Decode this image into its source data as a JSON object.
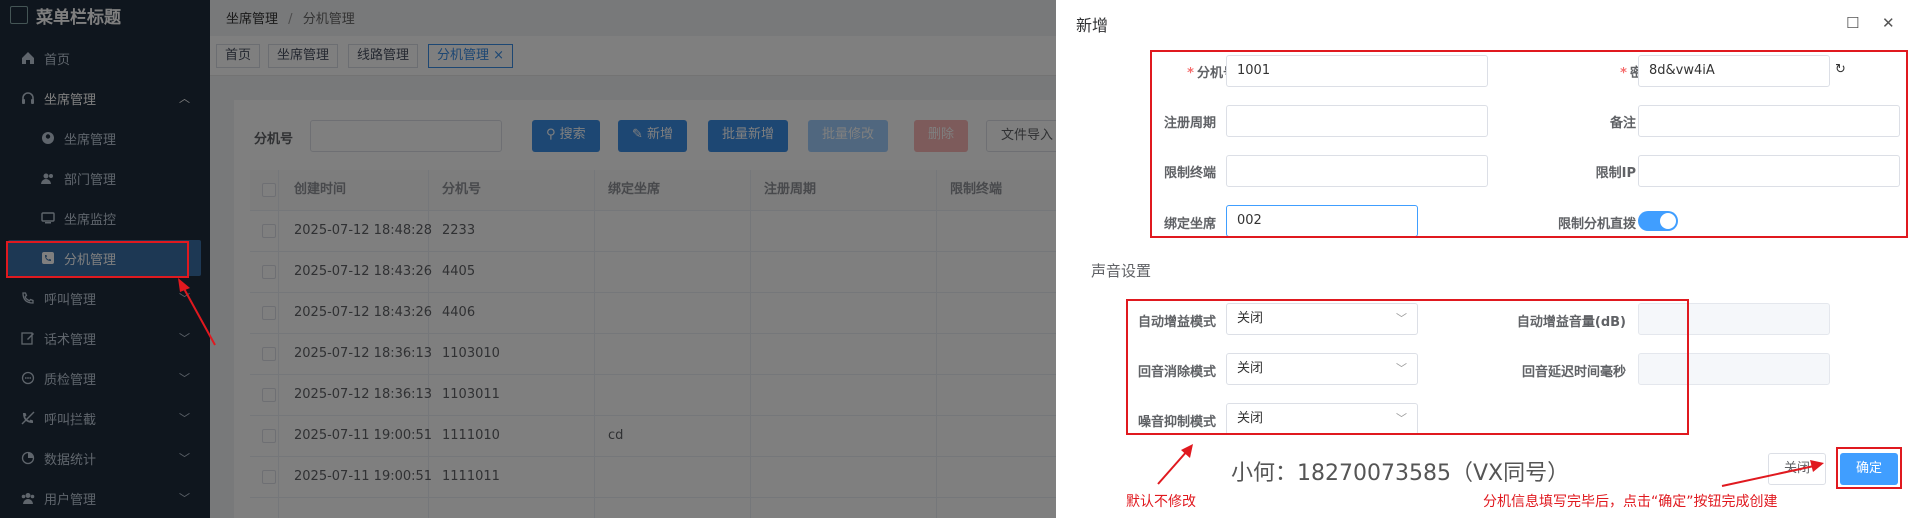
{
  "sidebar": {
    "title": "菜单栏标题",
    "items": [
      {
        "label": "首页",
        "icon": "home-icon"
      },
      {
        "label": "坐席管理",
        "icon": "headset-icon",
        "expanded": true
      },
      {
        "label": "坐席管理",
        "icon": "user-circle-icon",
        "sub": true
      },
      {
        "label": "部门管理",
        "icon": "users-icon",
        "sub": true
      },
      {
        "label": "坐席监控",
        "icon": "monitor-icon",
        "sub": true
      },
      {
        "label": "分机管理",
        "icon": "phone-icon",
        "sub": true,
        "active": true
      },
      {
        "label": "呼叫管理",
        "icon": "phone-call-icon"
      },
      {
        "label": "话术管理",
        "icon": "edit-icon"
      },
      {
        "label": "质检管理",
        "icon": "chat-icon"
      },
      {
        "label": "呼叫拦截",
        "icon": "block-icon"
      },
      {
        "label": "数据统计",
        "icon": "chart-icon"
      },
      {
        "label": "用户管理",
        "icon": "user-group-icon"
      }
    ]
  },
  "breadcrumb": {
    "first": "坐席管理",
    "sep": "/",
    "current": "分机管理"
  },
  "tabs": [
    "首页",
    "坐席管理",
    "线路管理",
    "分机管理 ×"
  ],
  "search": {
    "label": "分机号",
    "buttons": [
      "搜索",
      "新增",
      "批量新增",
      "批量修改",
      "删除",
      "文件导入"
    ]
  },
  "table": {
    "headers": [
      "创建时间",
      "分机号",
      "绑定坐席",
      "注册周期",
      "限制终端"
    ],
    "rows": [
      [
        "2025-07-12 18:48:28",
        "2233",
        ""
      ],
      [
        "2025-07-12 18:43:26",
        "4405",
        ""
      ],
      [
        "2025-07-12 18:43:26",
        "4406",
        ""
      ],
      [
        "2025-07-12 18:36:13",
        "1103010",
        ""
      ],
      [
        "2025-07-12 18:36:13",
        "1103011",
        ""
      ],
      [
        "2025-07-11 19:00:51",
        "1111010",
        "cd"
      ],
      [
        "2025-07-11 19:00:51",
        "1111011",
        ""
      ]
    ]
  },
  "dialog": {
    "title": "新增",
    "fields": {
      "ext_label": "分机号",
      "ext_value": "1001",
      "pwd_label": "密码",
      "pwd_value": "8d&vw4iA",
      "reg_label": "注册周期",
      "note_label": "备注",
      "term_label": "限制终端",
      "ip_label": "限制IP",
      "bind_label": "绑定坐席",
      "bind_value": "002",
      "direct_label": "限制分机直拨",
      "direct_on": true
    },
    "sound": {
      "title": "声音设置",
      "agc_label": "自动增益模式",
      "agc_value": "关闭",
      "agc_vol_label": "自动增益音量(dB)",
      "aec_label": "回音消除模式",
      "aec_value": "关闭",
      "aec_delay_label": "回音延迟时间毫秒",
      "ns_label": "噪音抑制模式",
      "ns_value": "关闭"
    },
    "close_button": "关闭",
    "confirm_button": "确定"
  },
  "annotations": {
    "left_note": "默认不修改",
    "right_note": "分机信息填写完毕后，点击“确定”按钮完成创建",
    "watermark": "小何：18270073585（VX同号）"
  },
  "colors": {
    "sidebar_bg": "#1f2d3d",
    "primary": "#409eff",
    "annotation_red": "#e0191f"
  }
}
